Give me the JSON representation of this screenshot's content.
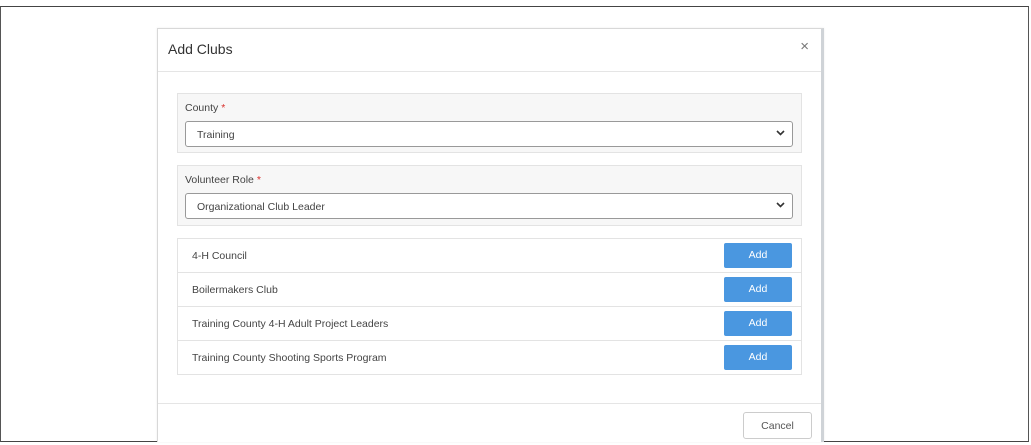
{
  "modal": {
    "title": "Add Clubs",
    "close_glyph": "×",
    "close_icon": "close-icon"
  },
  "county": {
    "label": "County",
    "required_mark": "*",
    "value": "Training",
    "chevron_icon": "chevron-down-icon"
  },
  "volunteer_role": {
    "label": "Volunteer Role",
    "required_mark": "*",
    "value": "Organizational Club Leader",
    "chevron_icon": "chevron-down-icon"
  },
  "clubs": [
    {
      "name": "4-H Council",
      "action": "Add"
    },
    {
      "name": "Boilermakers Club",
      "action": "Add"
    },
    {
      "name": "Training County 4-H Adult Project Leaders",
      "action": "Add"
    },
    {
      "name": "Training County Shooting Sports Program",
      "action": "Add"
    }
  ],
  "footer": {
    "cancel_label": "Cancel"
  },
  "colors": {
    "add_button": "#4a97e0",
    "required": "#d9302c"
  }
}
